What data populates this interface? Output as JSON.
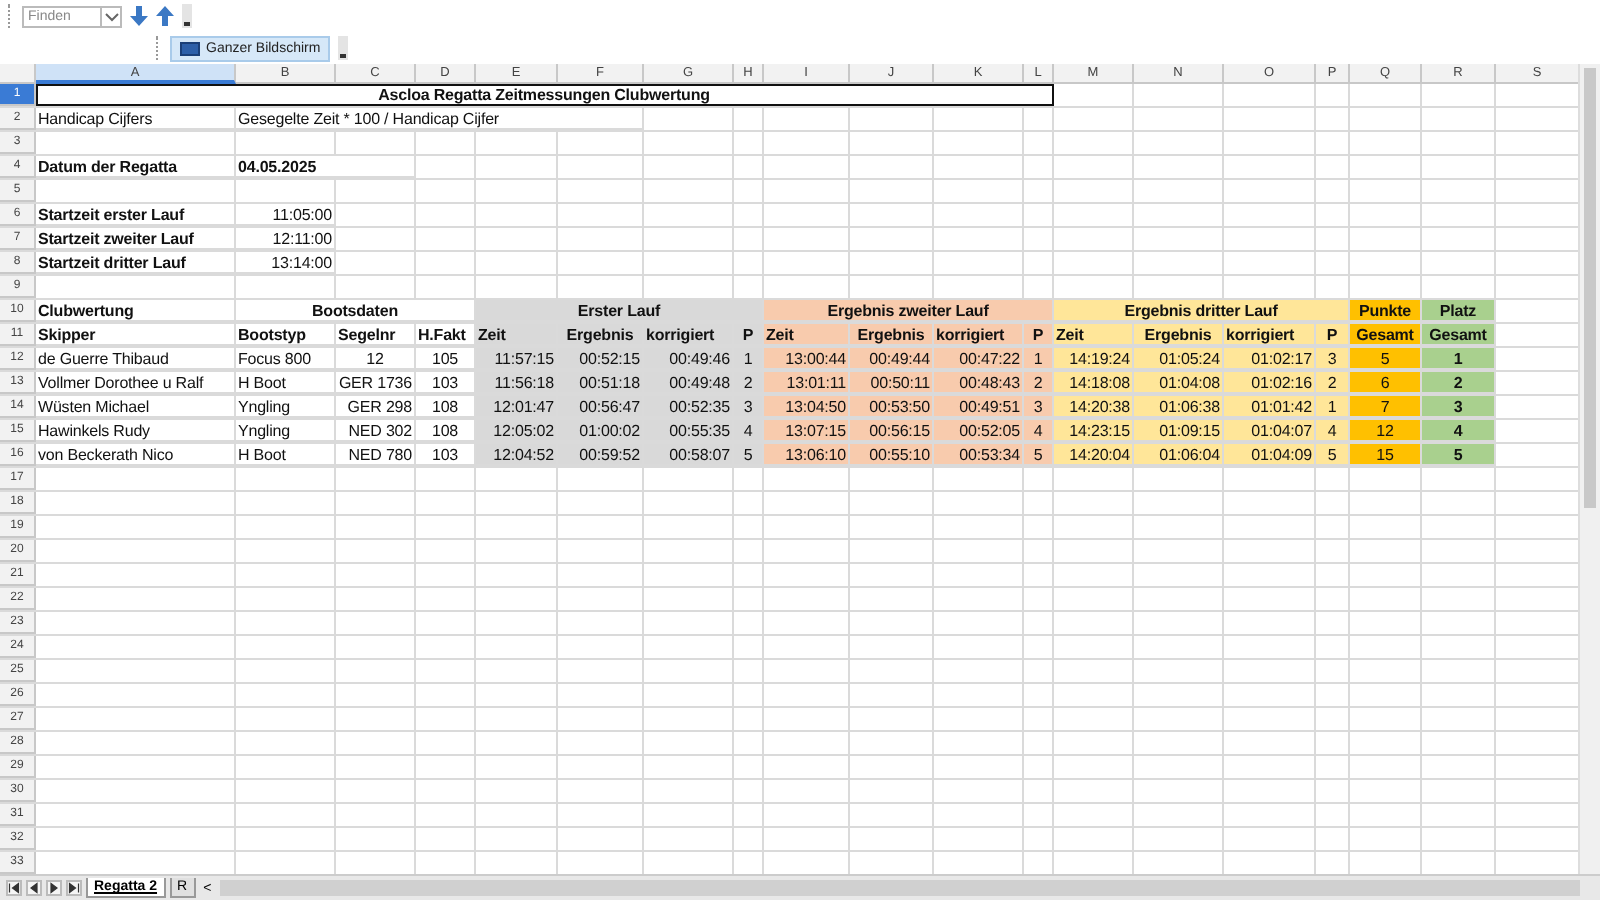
{
  "toolbar": {
    "search": {
      "placeholder": "Finden"
    },
    "fullscreen_button": "Ganzer Bildschirm"
  },
  "columns": [
    {
      "label": "A",
      "selected": true
    },
    {
      "label": "B",
      "selected": false
    },
    {
      "label": "C",
      "selected": false
    },
    {
      "label": "D",
      "selected": false
    },
    {
      "label": "E",
      "selected": false
    },
    {
      "label": "F",
      "selected": false
    },
    {
      "label": "G",
      "selected": false
    },
    {
      "label": "H",
      "selected": false
    },
    {
      "label": "I",
      "selected": false
    },
    {
      "label": "J",
      "selected": false
    },
    {
      "label": "K",
      "selected": false
    },
    {
      "label": "L",
      "selected": false
    },
    {
      "label": "M",
      "selected": false
    },
    {
      "label": "N",
      "selected": false
    },
    {
      "label": "O",
      "selected": false
    },
    {
      "label": "P",
      "selected": false
    },
    {
      "label": "Q",
      "selected": false
    },
    {
      "label": "R",
      "selected": false
    },
    {
      "label": "S",
      "selected": false
    }
  ],
  "rows": [
    {
      "number": "1",
      "selected": true,
      "cells": [
        {
          "text": "Ascloa Regatta Zeitmessungen Clubwertung",
          "bold": true,
          "centered": true,
          "framed": true
        },
        null,
        null,
        null,
        null,
        null,
        null,
        null,
        null,
        null,
        null,
        null
      ]
    },
    {
      "number": "2",
      "selected": false,
      "cells": [
        {
          "text": "Handicap Cijfers"
        },
        {
          "text": "Gesegelte Zeit * 100 / Handicap Cijfer"
        },
        null,
        null,
        null,
        null
      ]
    },
    {
      "number": "3",
      "selected": false,
      "cells": []
    },
    {
      "number": "4",
      "selected": false,
      "cells": [
        {
          "text": "Datum der Regatta",
          "bold": true
        },
        {
          "text": "04.05.2025",
          "bold": true
        },
        null
      ]
    },
    {
      "number": "5",
      "selected": false,
      "cells": []
    },
    {
      "number": "6",
      "selected": false,
      "cells": [
        {
          "text": "Startzeit erster Lauf",
          "bold": true
        },
        {
          "text": "11:05:00",
          "align_right": true
        }
      ]
    },
    {
      "number": "7",
      "selected": false,
      "cells": [
        {
          "text": "Startzeit zweiter Lauf",
          "bold": true
        },
        {
          "text": "12:11:00",
          "align_right": true
        }
      ]
    },
    {
      "number": "8",
      "selected": false,
      "cells": [
        {
          "text": "Startzeit dritter Lauf",
          "bold": true
        },
        {
          "text": "13:14:00",
          "align_right": true
        }
      ]
    },
    {
      "number": "9",
      "selected": false,
      "cells": []
    },
    {
      "number": "10",
      "selected": false,
      "cells": [
        {
          "text": "Clubwertung",
          "bold": true
        },
        {
          "text": "Bootsdaten",
          "bold": true,
          "centered": true
        },
        null,
        null,
        {
          "text": "Erster Lauf",
          "bold": true,
          "centered": true,
          "color": "#d9d9d9"
        },
        null,
        null,
        null,
        {
          "text": "Ergebnis zweiter Lauf",
          "bold": true,
          "centered": true,
          "color": "#f8cbad"
        },
        null,
        null,
        null,
        {
          "text": "Ergebnis dritter Lauf",
          "bold": true,
          "centered": true,
          "color": "#ffe699"
        },
        null,
        null,
        null,
        {
          "text": "Punkte",
          "bold": true,
          "centered": true,
          "color": "#ffc000"
        },
        {
          "text": "Platz",
          "bold": true,
          "centered": true,
          "color": "#a9d08e"
        }
      ]
    },
    {
      "number": "11",
      "selected": false,
      "cells": [
        {
          "text": "Skipper",
          "bold": true
        },
        {
          "text": "Bootstyp",
          "bold": true
        },
        {
          "text": "Segelnr",
          "bold": true
        },
        {
          "text": "H.Fakt",
          "bold": true
        },
        {
          "text": "Zeit",
          "bold": true,
          "color": "#d9d9d9"
        },
        {
          "text": "Ergebnis",
          "bold": true,
          "centered": true,
          "color": "#d9d9d9"
        },
        {
          "text": "korrigiert",
          "bold": true,
          "color": "#d9d9d9"
        },
        {
          "text": "P",
          "bold": true,
          "centered": true,
          "color": "#d9d9d9"
        },
        {
          "text": "Zeit",
          "bold": true,
          "color": "#f8cbad"
        },
        {
          "text": "Ergebnis",
          "bold": true,
          "centered": true,
          "color": "#f8cbad"
        },
        {
          "text": "korrigiert",
          "bold": true,
          "color": "#f8cbad"
        },
        {
          "text": "P",
          "bold": true,
          "centered": true,
          "color": "#f8cbad"
        },
        {
          "text": "Zeit",
          "bold": true,
          "color": "#ffe699"
        },
        {
          "text": "Ergebnis",
          "bold": true,
          "centered": true,
          "color": "#ffe699"
        },
        {
          "text": "korrigiert",
          "bold": true,
          "color": "#ffe699"
        },
        {
          "text": "P",
          "bold": true,
          "centered": true,
          "color": "#ffe699"
        },
        {
          "text": "Gesamt",
          "bold": true,
          "centered": true,
          "color": "#ffc000"
        },
        {
          "text": "Gesamt",
          "bold": true,
          "centered": true,
          "color": "#a9d08e"
        }
      ]
    },
    {
      "number": "12",
      "selected": false,
      "cells": [
        {
          "text": "de Guerre Thibaud"
        },
        {
          "text": "Focus 800"
        },
        {
          "text": "12",
          "centered": true
        },
        {
          "text": "105",
          "centered": true
        },
        {
          "text": "11:57:15",
          "align_right": true,
          "color": "#d9d9d9"
        },
        {
          "text": "00:52:15",
          "align_right": true,
          "color": "#d9d9d9"
        },
        {
          "text": "00:49:46",
          "align_right": true,
          "color": "#d9d9d9"
        },
        {
          "text": "1",
          "centered": true,
          "color": "#d9d9d9"
        },
        {
          "text": "13:00:44",
          "align_right": true,
          "color": "#f8cbad"
        },
        {
          "text": "00:49:44",
          "align_right": true,
          "color": "#f8cbad"
        },
        {
          "text": "00:47:22",
          "align_right": true,
          "color": "#f8cbad"
        },
        {
          "text": "1",
          "centered": true,
          "color": "#f8cbad"
        },
        {
          "text": "14:19:24",
          "align_right": true,
          "color": "#ffe699"
        },
        {
          "text": "01:05:24",
          "align_right": true,
          "color": "#ffe699"
        },
        {
          "text": "01:02:17",
          "align_right": true,
          "color": "#ffe699"
        },
        {
          "text": "3",
          "centered": true,
          "color": "#ffe699"
        },
        {
          "text": "5",
          "centered": true,
          "color": "#ffc000"
        },
        {
          "text": "1",
          "bold": true,
          "centered": true,
          "color": "#a9d08e"
        }
      ]
    },
    {
      "number": "13",
      "selected": false,
      "cells": [
        {
          "text": "Vollmer Dorothee u Ralf"
        },
        {
          "text": "H Boot"
        },
        {
          "text": "GER 1736",
          "align_right": true
        },
        {
          "text": "103",
          "centered": true
        },
        {
          "text": "11:56:18",
          "align_right": true,
          "color": "#d9d9d9"
        },
        {
          "text": "00:51:18",
          "align_right": true,
          "color": "#d9d9d9"
        },
        {
          "text": "00:49:48",
          "align_right": true,
          "color": "#d9d9d9"
        },
        {
          "text": "2",
          "centered": true,
          "color": "#d9d9d9"
        },
        {
          "text": "13:01:11",
          "align_right": true,
          "color": "#f8cbad"
        },
        {
          "text": "00:50:11",
          "align_right": true,
          "color": "#f8cbad"
        },
        {
          "text": "00:48:43",
          "align_right": true,
          "color": "#f8cbad"
        },
        {
          "text": "2",
          "centered": true,
          "color": "#f8cbad"
        },
        {
          "text": "14:18:08",
          "align_right": true,
          "color": "#ffe699"
        },
        {
          "text": "01:04:08",
          "align_right": true,
          "color": "#ffe699"
        },
        {
          "text": "01:02:16",
          "align_right": true,
          "color": "#ffe699"
        },
        {
          "text": "2",
          "centered": true,
          "color": "#ffe699"
        },
        {
          "text": "6",
          "centered": true,
          "color": "#ffc000"
        },
        {
          "text": "2",
          "bold": true,
          "centered": true,
          "color": "#a9d08e"
        }
      ]
    },
    {
      "number": "14",
      "selected": false,
      "cells": [
        {
          "text": "Wüsten Michael"
        },
        {
          "text": "Yngling"
        },
        {
          "text": "GER 298",
          "align_right": true
        },
        {
          "text": "108",
          "centered": true
        },
        {
          "text": "12:01:47",
          "align_right": true,
          "color": "#d9d9d9"
        },
        {
          "text": "00:56:47",
          "align_right": true,
          "color": "#d9d9d9"
        },
        {
          "text": "00:52:35",
          "align_right": true,
          "color": "#d9d9d9"
        },
        {
          "text": "3",
          "centered": true,
          "color": "#d9d9d9"
        },
        {
          "text": "13:04:50",
          "align_right": true,
          "color": "#f8cbad"
        },
        {
          "text": "00:53:50",
          "align_right": true,
          "color": "#f8cbad"
        },
        {
          "text": "00:49:51",
          "align_right": true,
          "color": "#f8cbad"
        },
        {
          "text": "3",
          "centered": true,
          "color": "#f8cbad"
        },
        {
          "text": "14:20:38",
          "align_right": true,
          "color": "#ffe699"
        },
        {
          "text": "01:06:38",
          "align_right": true,
          "color": "#ffe699"
        },
        {
          "text": "01:01:42",
          "align_right": true,
          "color": "#ffe699"
        },
        {
          "text": "1",
          "centered": true,
          "color": "#ffe699"
        },
        {
          "text": "7",
          "centered": true,
          "color": "#ffc000"
        },
        {
          "text": "3",
          "bold": true,
          "centered": true,
          "color": "#a9d08e"
        }
      ]
    },
    {
      "number": "15",
      "selected": false,
      "cells": [
        {
          "text": "Hawinkels Rudy"
        },
        {
          "text": "Yngling"
        },
        {
          "text": "NED 302",
          "align_right": true
        },
        {
          "text": "108",
          "centered": true
        },
        {
          "text": "12:05:02",
          "align_right": true,
          "color": "#d9d9d9"
        },
        {
          "text": "01:00:02",
          "align_right": true,
          "color": "#d9d9d9"
        },
        {
          "text": "00:55:35",
          "align_right": true,
          "color": "#d9d9d9"
        },
        {
          "text": "4",
          "centered": true,
          "color": "#d9d9d9"
        },
        {
          "text": "13:07:15",
          "align_right": true,
          "color": "#f8cbad"
        },
        {
          "text": "00:56:15",
          "align_right": true,
          "color": "#f8cbad"
        },
        {
          "text": "00:52:05",
          "align_right": true,
          "color": "#f8cbad"
        },
        {
          "text": "4",
          "centered": true,
          "color": "#f8cbad"
        },
        {
          "text": "14:23:15",
          "align_right": true,
          "color": "#ffe699"
        },
        {
          "text": "01:09:15",
          "align_right": true,
          "color": "#ffe699"
        },
        {
          "text": "01:04:07",
          "align_right": true,
          "color": "#ffe699"
        },
        {
          "text": "4",
          "centered": true,
          "color": "#ffe699"
        },
        {
          "text": "12",
          "centered": true,
          "color": "#ffc000"
        },
        {
          "text": "4",
          "bold": true,
          "centered": true,
          "color": "#a9d08e"
        }
      ]
    },
    {
      "number": "16",
      "selected": false,
      "cells": [
        {
          "text": "von Beckerath Nico"
        },
        {
          "text": "H Boot"
        },
        {
          "text": "NED 780",
          "align_right": true
        },
        {
          "text": "103",
          "centered": true
        },
        {
          "text": "12:04:52",
          "align_right": true,
          "color": "#d9d9d9"
        },
        {
          "text": "00:59:52",
          "align_right": true,
          "color": "#d9d9d9"
        },
        {
          "text": "00:58:07",
          "align_right": true,
          "color": "#d9d9d9"
        },
        {
          "text": "5",
          "centered": true,
          "color": "#d9d9d9"
        },
        {
          "text": "13:06:10",
          "align_right": true,
          "color": "#f8cbad"
        },
        {
          "text": "00:55:10",
          "align_right": true,
          "color": "#f8cbad"
        },
        {
          "text": "00:53:34",
          "align_right": true,
          "color": "#f8cbad"
        },
        {
          "text": "5",
          "centered": true,
          "color": "#f8cbad"
        },
        {
          "text": "14:20:04",
          "align_right": true,
          "color": "#ffe699"
        },
        {
          "text": "01:06:04",
          "align_right": true,
          "color": "#ffe699"
        },
        {
          "text": "01:04:09",
          "align_right": true,
          "color": "#ffe699"
        },
        {
          "text": "5",
          "centered": true,
          "color": "#ffe699"
        },
        {
          "text": "15",
          "centered": true,
          "color": "#ffc000"
        },
        {
          "text": "5",
          "bold": true,
          "centered": true,
          "color": "#a9d08e"
        }
      ]
    },
    {
      "number": "17",
      "selected": false,
      "cells": []
    },
    {
      "number": "18",
      "selected": false,
      "cells": []
    },
    {
      "number": "19",
      "selected": false,
      "cells": []
    },
    {
      "number": "20",
      "selected": false,
      "cells": []
    },
    {
      "number": "21",
      "selected": false,
      "cells": []
    },
    {
      "number": "22",
      "selected": false,
      "cells": []
    },
    {
      "number": "23",
      "selected": false,
      "cells": []
    },
    {
      "number": "24",
      "selected": false,
      "cells": []
    },
    {
      "number": "25",
      "selected": false,
      "cells": []
    },
    {
      "number": "26",
      "selected": false,
      "cells": []
    },
    {
      "number": "27",
      "selected": false,
      "cells": []
    },
    {
      "number": "28",
      "selected": false,
      "cells": []
    },
    {
      "number": "29",
      "selected": false,
      "cells": []
    },
    {
      "number": "30",
      "selected": false,
      "cells": []
    },
    {
      "number": "31",
      "selected": false,
      "cells": []
    },
    {
      "number": "32",
      "selected": false,
      "cells": []
    },
    {
      "number": "33",
      "selected": false,
      "cells": []
    }
  ],
  "sheet_tabs": [
    {
      "label": "Regatta 2",
      "selected": true
    },
    {
      "label": "R",
      "selected": false
    }
  ],
  "tab_scroll_button": "<"
}
